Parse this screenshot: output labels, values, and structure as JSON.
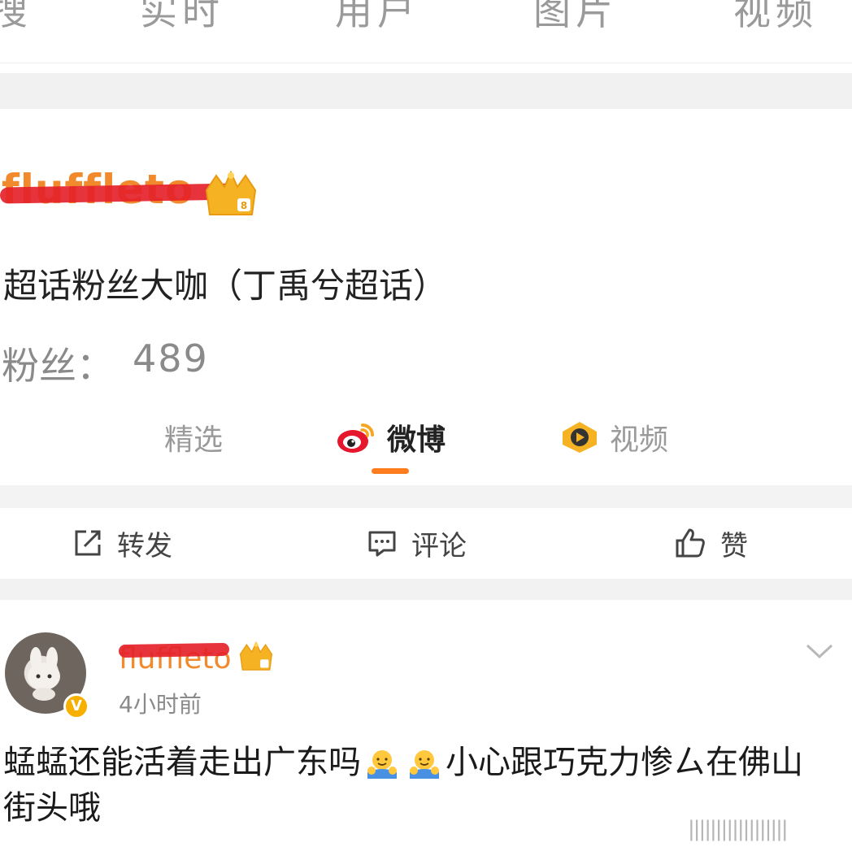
{
  "top_tabs": [
    "搜",
    "实时",
    "用户",
    "图片",
    "视频"
  ],
  "card": {
    "username": "fluffleto",
    "badge_text": "超话粉丝大咖（丁禹兮超话）",
    "fans_label": "粉丝：",
    "fans_count": "489",
    "tabs": [
      {
        "label": "精选",
        "icon": "none",
        "active": false
      },
      {
        "label": "微博",
        "icon": "weibo-logo-icon",
        "active": true
      },
      {
        "label": "视频",
        "icon": "video-play-icon",
        "active": false
      }
    ],
    "actions": [
      {
        "label": "转发",
        "icon": "repost-icon"
      },
      {
        "label": "评论",
        "icon": "comment-icon"
      },
      {
        "label": "赞",
        "icon": "thumbs-up-icon"
      }
    ]
  },
  "post": {
    "username": "fluffleto",
    "timestamp": "4小时前",
    "verified_badge": "V",
    "text_part1": "蜢蜢还能活着走出广东吗",
    "text_part2": "小心跟巧克力惨ㄙ在佛山街头哦",
    "emoji": "hugging-emoji"
  },
  "watermark": "||||||||||||||||||",
  "colors": {
    "accent_orange": "#ff7c1f",
    "username_orange": "#f08a2c",
    "scribble_red": "#e5222a",
    "weibo_red": "#e6162d",
    "crown_gold": "#f5b324"
  }
}
